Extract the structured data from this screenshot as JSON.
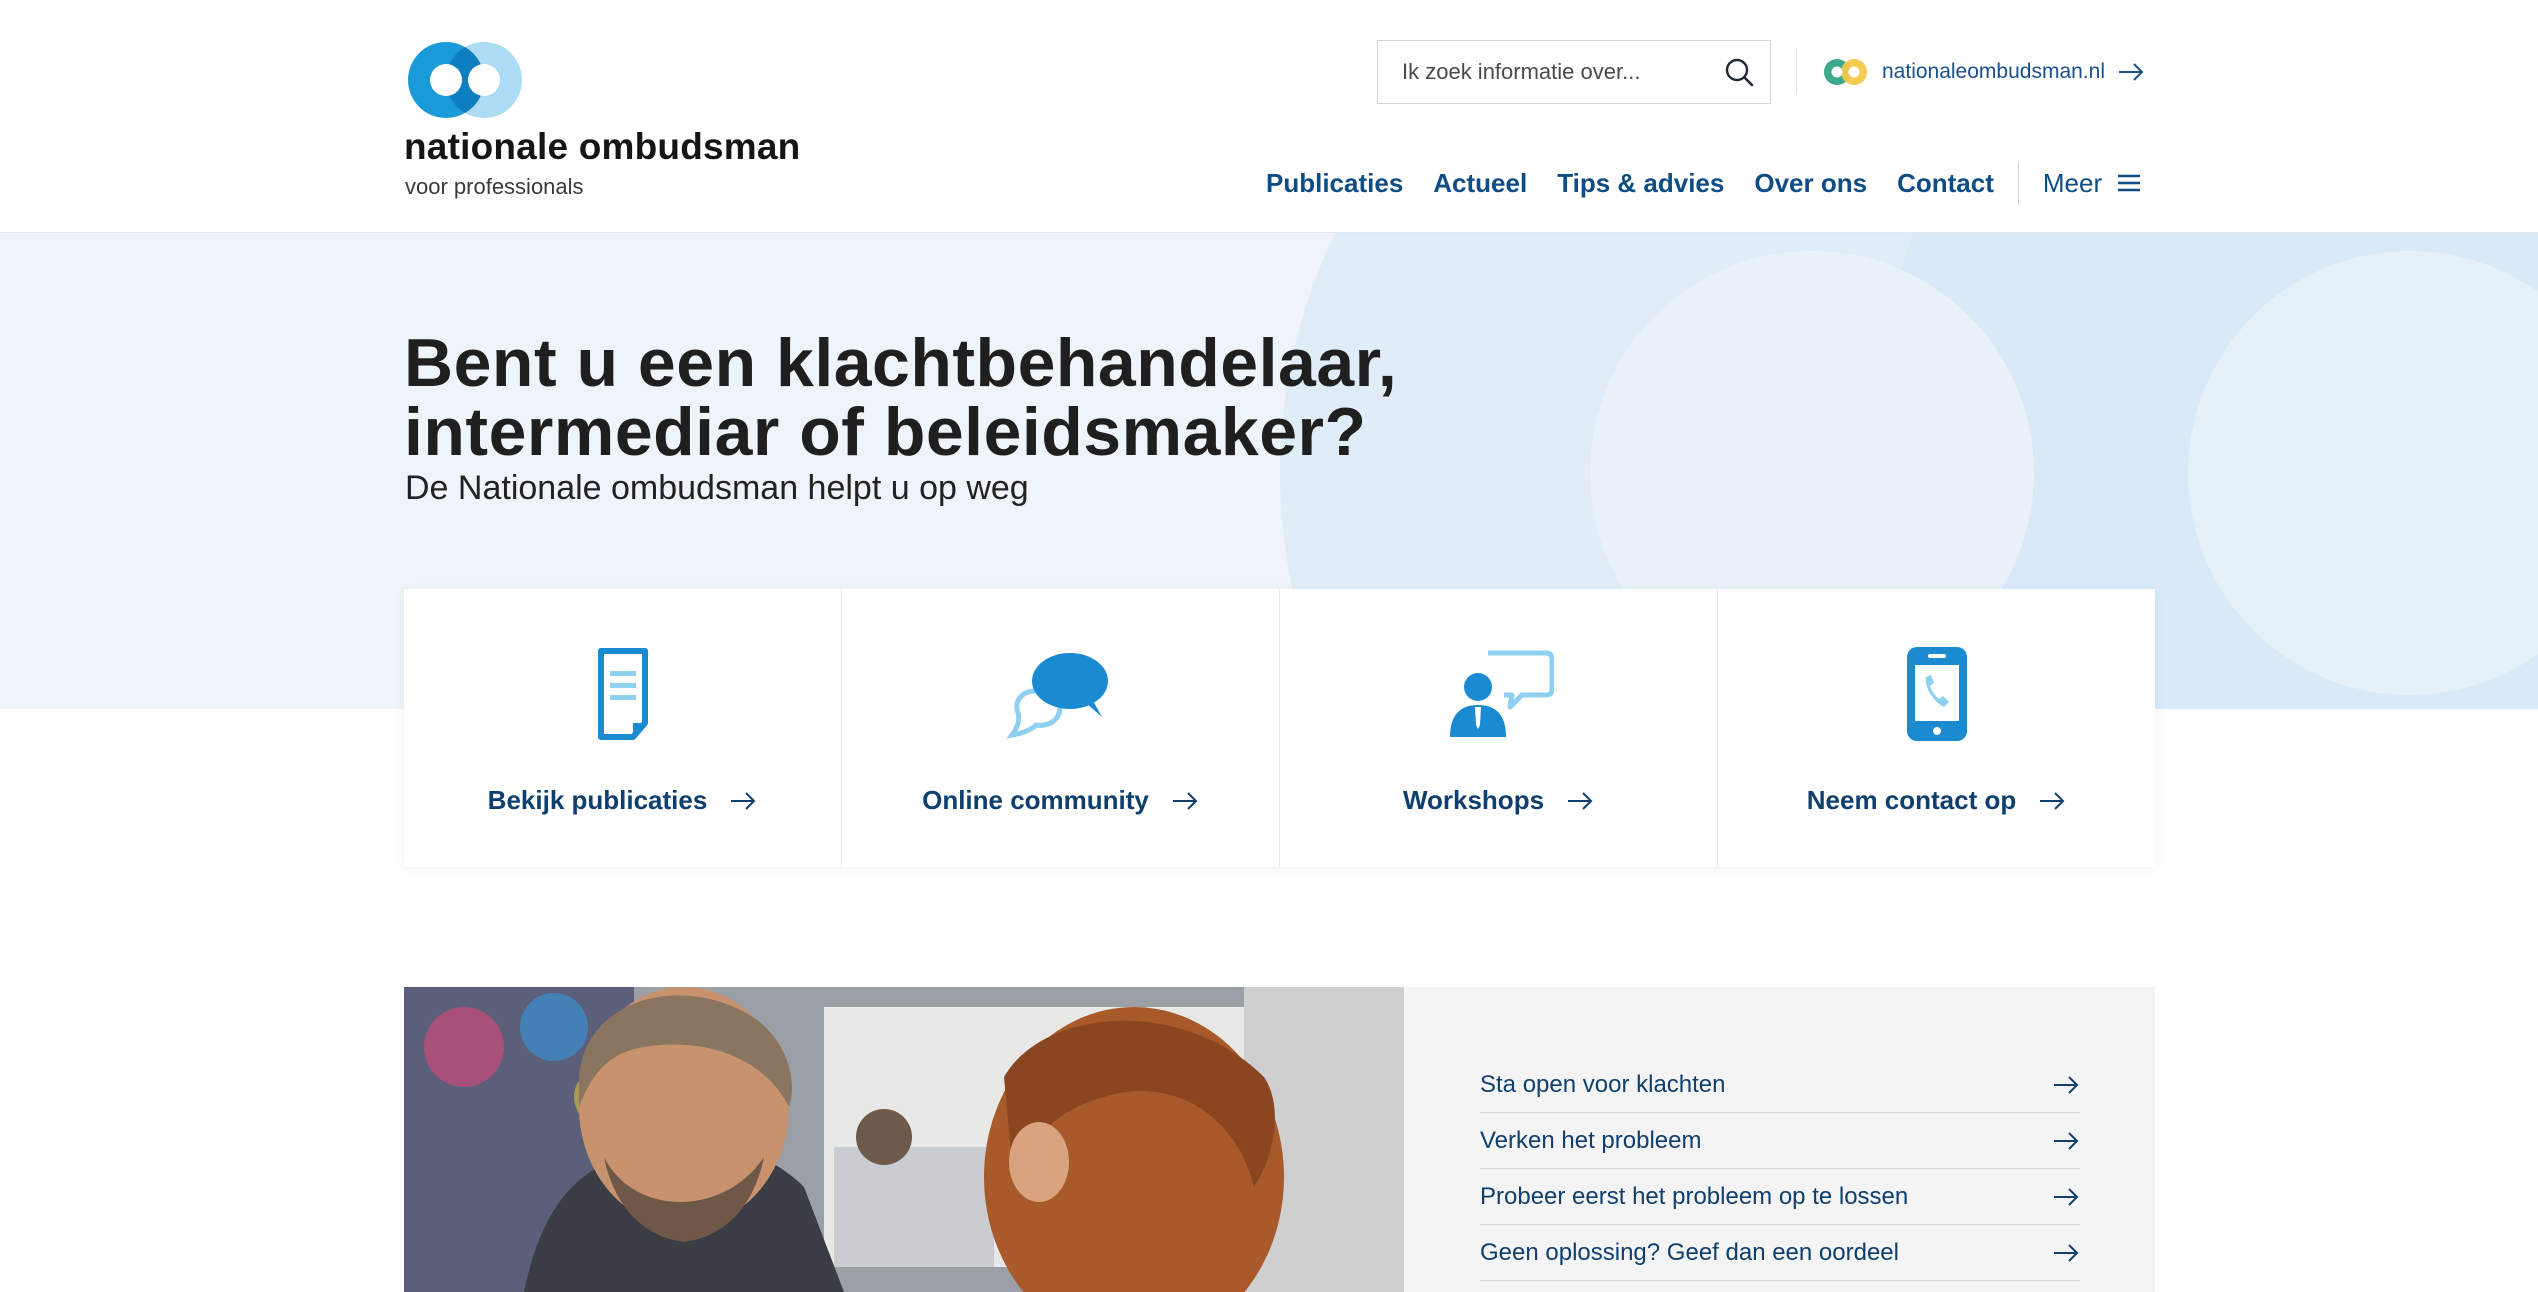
{
  "header": {
    "brand_name": "nationale ombudsman",
    "brand_sub": "voor professionals",
    "search_placeholder": "Ik zoek informatie over...",
    "external_link": "nationaleombudsman.nl"
  },
  "nav": {
    "items": [
      "Publicaties",
      "Actueel",
      "Tips & advies",
      "Over ons",
      "Contact"
    ],
    "more_label": "Meer"
  },
  "hero": {
    "title_line1": "Bent u een klachtbehandelaar,",
    "title_line2": "intermediar of beleidsmaker?",
    "subtitle": "De Nationale ombudsman helpt u op weg"
  },
  "cards": [
    {
      "label": "Bekijk publicaties",
      "icon": "document-icon"
    },
    {
      "label": "Online community",
      "icon": "chat-bubbles-icon"
    },
    {
      "label": "Workshops",
      "icon": "presenter-icon"
    },
    {
      "label": "Neem contact op",
      "icon": "phone-icon"
    }
  ],
  "steps": [
    "Sta open voor klachten",
    "Verken het probleem",
    "Probeer eerst het probleem op te lossen",
    "Geen oplossing? Geef dan een oordeel"
  ],
  "colors": {
    "nav_blue": "#0e4c86",
    "card_text": "#0e3f6e",
    "brand_blue": "#1a9bd7",
    "brand_light": "#a9d9f3",
    "hero_bg": "#eef4f9"
  }
}
